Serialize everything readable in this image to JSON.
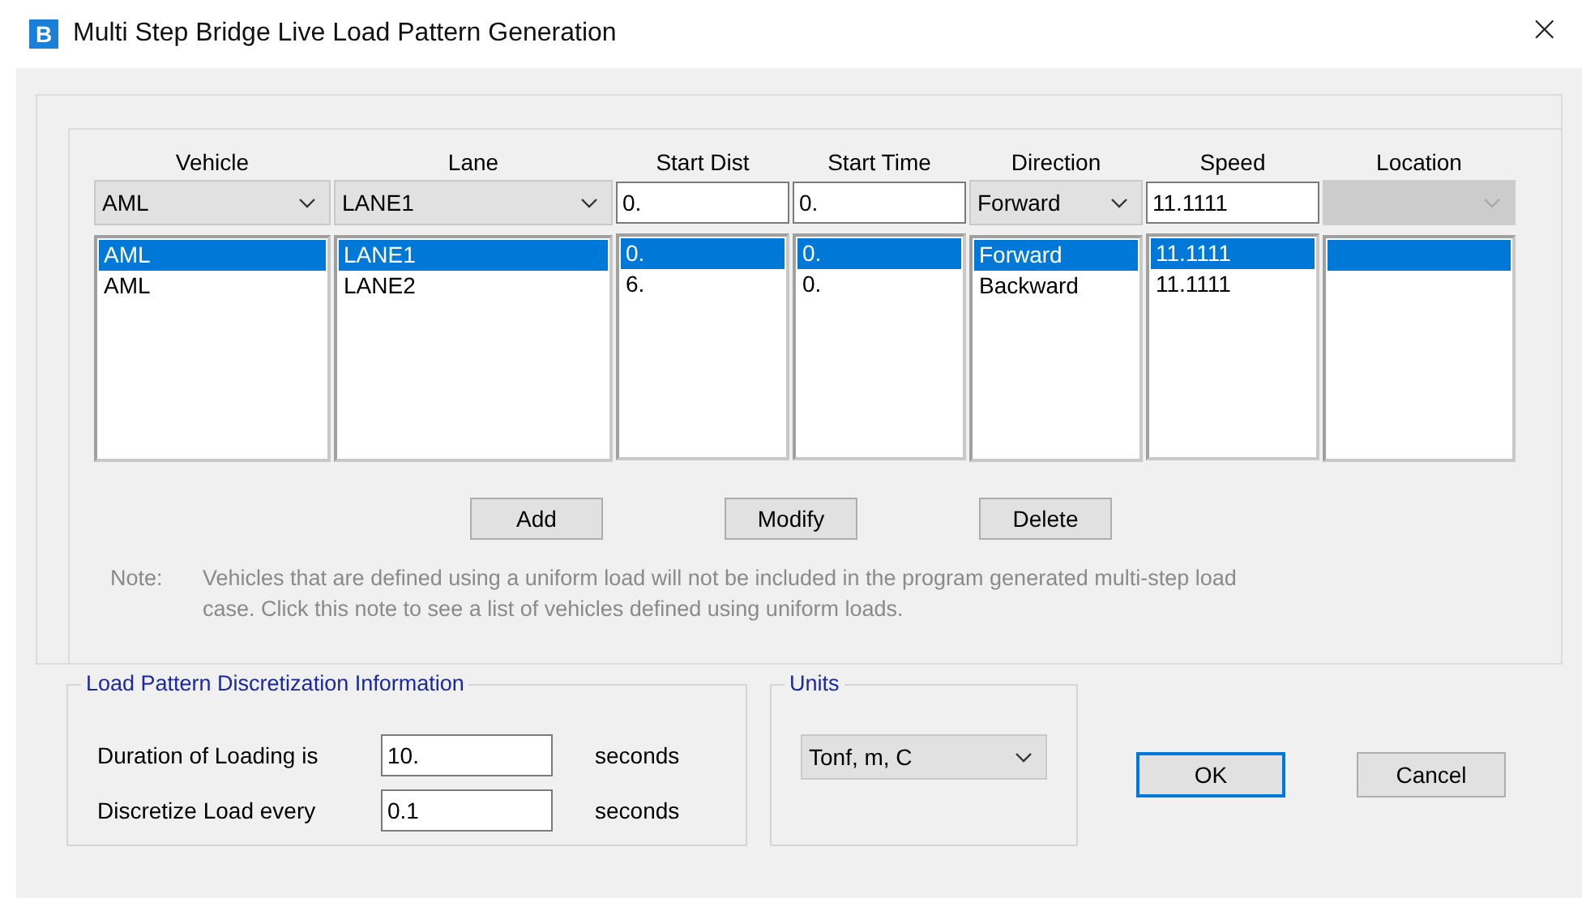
{
  "window": {
    "title": "Multi Step Bridge Live Load Pattern Generation",
    "app_letter": "B",
    "close": "×"
  },
  "table": {
    "columns": [
      {
        "header": "Vehicle",
        "editor": {
          "kind": "combo",
          "value": "AML",
          "disabled": false
        }
      },
      {
        "header": "Lane",
        "editor": {
          "kind": "combo",
          "value": "LANE1",
          "disabled": false
        }
      },
      {
        "header": "Start Dist",
        "editor": {
          "kind": "text",
          "value": "0."
        }
      },
      {
        "header": "Start Time",
        "editor": {
          "kind": "text",
          "value": "0."
        }
      },
      {
        "header": "Direction",
        "editor": {
          "kind": "combo",
          "value": "Forward",
          "disabled": false
        }
      },
      {
        "header": "Speed",
        "editor": {
          "kind": "text",
          "value": "11.1111"
        }
      },
      {
        "header": "Location",
        "editor": {
          "kind": "combo",
          "disabled": true
        }
      }
    ],
    "rows": [
      {
        "selected": true,
        "cells": [
          "AML",
          "LANE1",
          "0.",
          "0.",
          "Forward",
          "11.1111"
        ]
      },
      {
        "selected": false,
        "cells": [
          "AML",
          "LANE2",
          "6.",
          "0.",
          "Backward",
          "11.1111"
        ]
      }
    ]
  },
  "buttons": [
    "Add",
    "Modify",
    "Delete"
  ],
  "note": {
    "label": "Note:",
    "text": "Vehicles that are defined using a uniform load will not be included in the program generated multi-step load case.  Click this note to see a list of vehicles defined using uniform loads."
  },
  "discretization": {
    "title": "Load Pattern Discretization Information",
    "fields": [
      {
        "label": "Duration of Loading is",
        "value": "10.",
        "unit": "seconds"
      },
      {
        "label": "Discretize Load every",
        "value": "0.1",
        "unit": "seconds"
      }
    ]
  },
  "units": {
    "title": "Units",
    "value": "Tonf, m, C"
  },
  "dialog_buttons": [
    {
      "label": "OK",
      "default": true
    },
    {
      "label": "Cancel",
      "default": false
    }
  ]
}
